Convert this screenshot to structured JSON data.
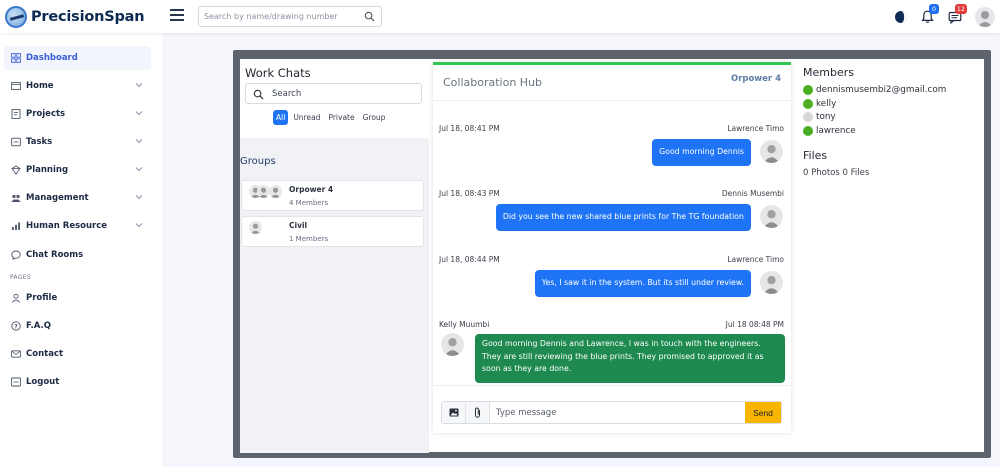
{
  "app": {
    "name": "PrecisionSpan",
    "search_placeholder": "Search by name/drawing number",
    "notifications_count": "0",
    "messages_count": "12"
  },
  "sidebar": {
    "items": [
      {
        "label": "Dashboard",
        "icon": "dashboard-icon",
        "active": true
      },
      {
        "label": "Home",
        "icon": "home-icon"
      },
      {
        "label": "Projects",
        "icon": "projects-icon"
      },
      {
        "label": "Tasks",
        "icon": "tasks-icon"
      },
      {
        "label": "Planning",
        "icon": "planning-icon"
      },
      {
        "label": "Management",
        "icon": "management-icon"
      },
      {
        "label": "Human Resource",
        "icon": "human-resource-icon"
      },
      {
        "label": "Chat Rooms",
        "icon": "chat-icon"
      }
    ],
    "section_label": "PAGES",
    "pages": [
      {
        "label": "Profile",
        "icon": "profile-icon"
      },
      {
        "label": "F.A.Q",
        "icon": "faq-icon"
      },
      {
        "label": "Contact",
        "icon": "contact-icon"
      },
      {
        "label": "Logout",
        "icon": "logout-icon"
      }
    ]
  },
  "work_chats": {
    "title": "Work Chats",
    "search_placeholder": "Search",
    "filters": [
      "All",
      "Unread",
      "Private",
      "Group"
    ],
    "active_filter": "All",
    "groups_title": "Groups",
    "groups": [
      {
        "name": "Orpower 4",
        "members": "4 Members"
      },
      {
        "name": "Civil",
        "members": "1 Members"
      }
    ]
  },
  "hub": {
    "title": "Collaboration Hub",
    "group_name": "Orpower 4",
    "messages": [
      {
        "time": "Jul 18, 08:41 PM",
        "sender": "Lawrence Timo",
        "text": "Good morning Dennis",
        "own": true
      },
      {
        "time": "Jul 18, 08:43 PM",
        "sender": "Dennis Musembi",
        "text": "Did you see the new shared blue prints for The TG foundation",
        "own": true
      },
      {
        "time": "Jul 18, 08:44 PM",
        "sender": "Lawrence Timo",
        "text": "Yes, I saw it in the system. But its still under review.",
        "own": true
      },
      {
        "time": "Jul 18 08:48 PM",
        "sender": "Kelly Muumbi",
        "text": "Good morning Dennis and Lawrence, I was in touch with the engineers. They are still reviewing the blue prints. They promised to approved it as soon as they are done.",
        "own": false
      }
    ],
    "composer_placeholder": "Type message",
    "send_label": "Send"
  },
  "members": {
    "title": "Members",
    "list": [
      {
        "name": "dennismusembi2@gmail.com",
        "online": true
      },
      {
        "name": "kelly",
        "online": true
      },
      {
        "name": "tony",
        "online": false
      },
      {
        "name": "lawrence",
        "online": true
      }
    ],
    "files_title": "Files",
    "files_info": "0 Photos 0 Files"
  },
  "colors": {
    "primary": "#1f74f5",
    "success_bar": "#2bc552",
    "received_bubble": "#1f8a4f",
    "send_button": "#f7b500",
    "online_dot": "#4caf22",
    "offline_dot": "#d8d8d8"
  }
}
